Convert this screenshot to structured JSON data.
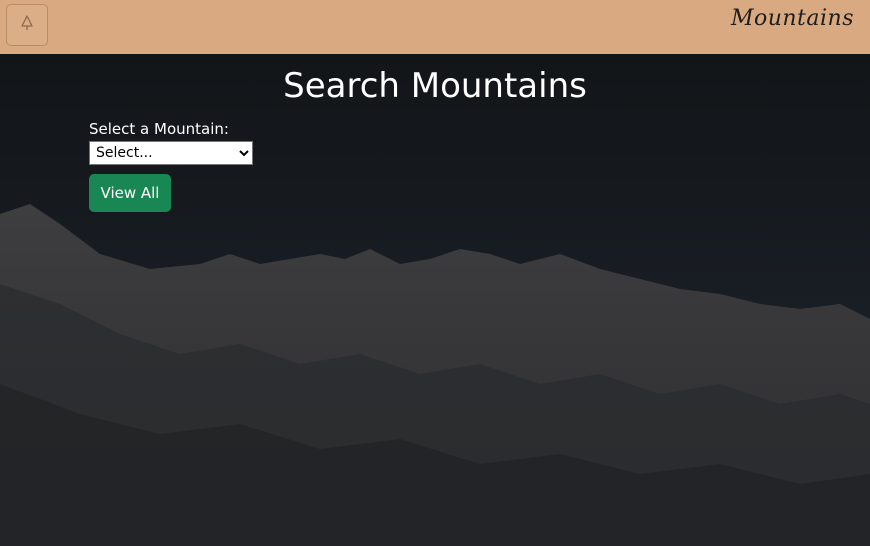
{
  "navbar": {
    "toggle_icon": "tree-icon",
    "brand": "Mountains"
  },
  "main": {
    "title": "Search Mountains",
    "select_label": "Select a Mountain:",
    "select_value": "Select...",
    "view_all_label": "View All"
  },
  "colors": {
    "navbar_bg": "#d9a981",
    "button_green": "#198754"
  }
}
